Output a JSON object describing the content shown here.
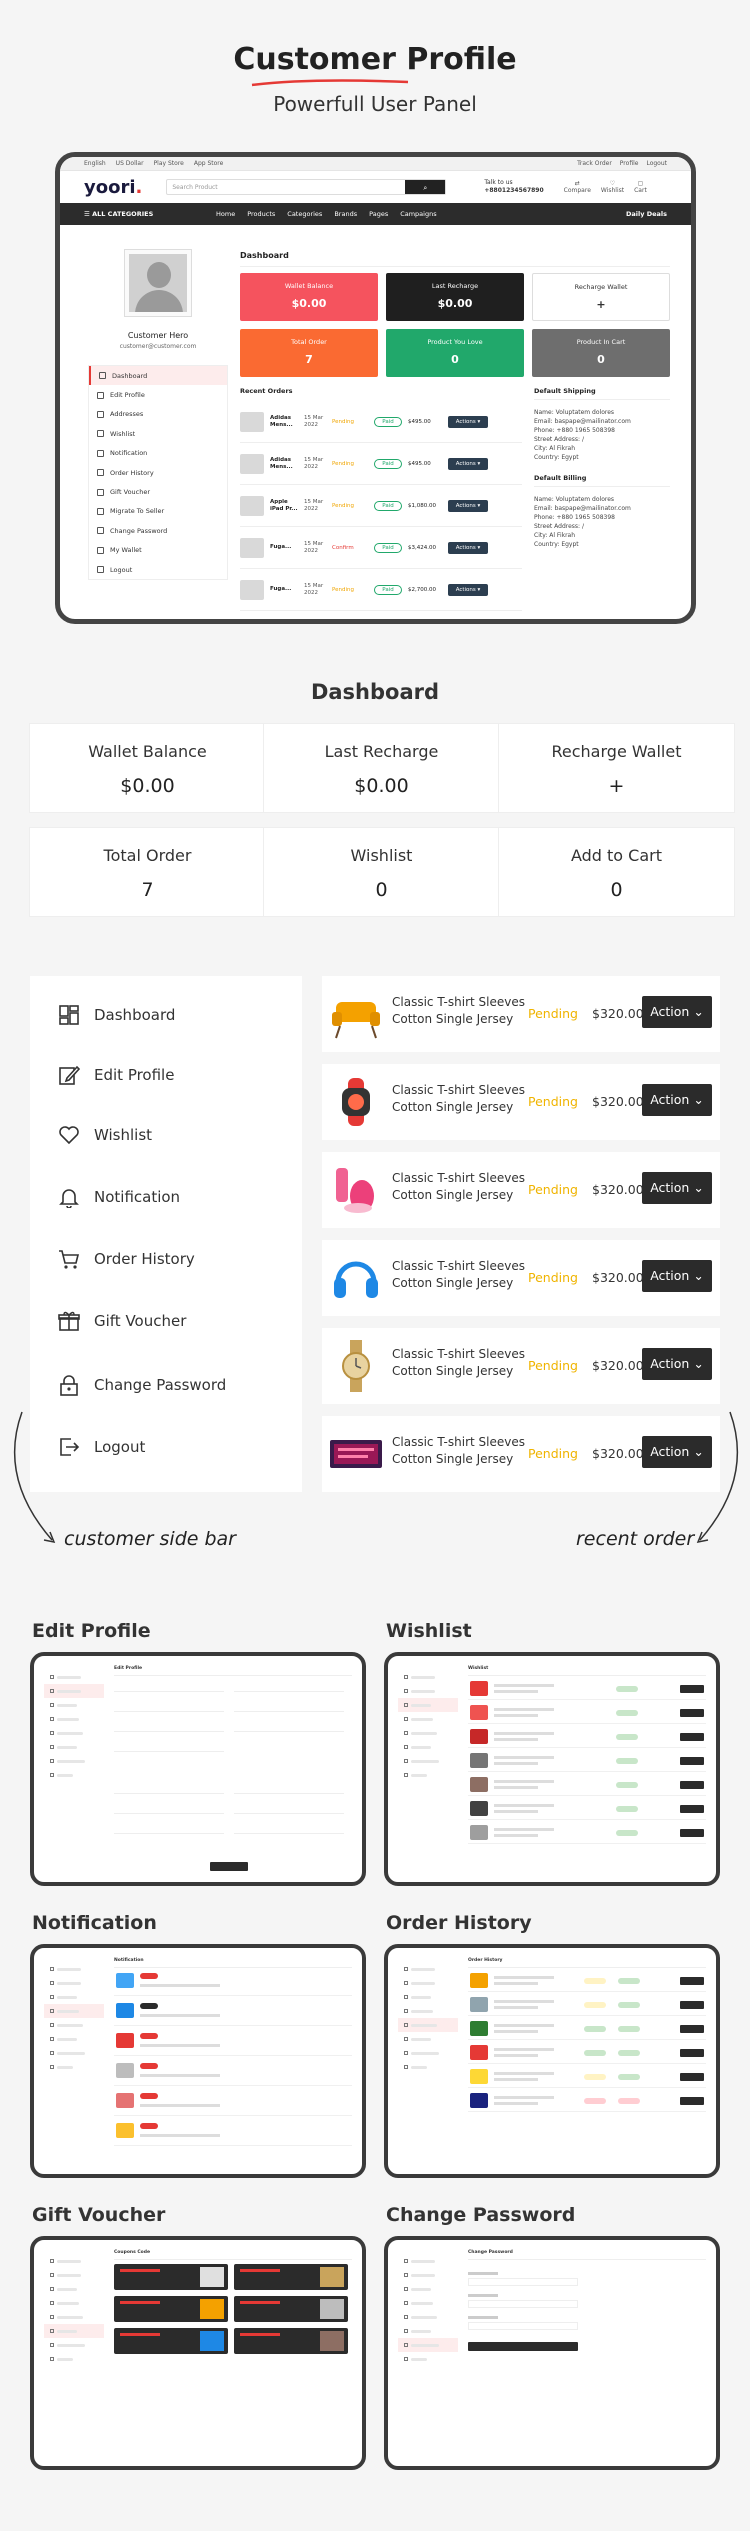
{
  "hero": {
    "title": "Customer Profile",
    "subtitle": "Powerfull User Panel"
  },
  "mock": {
    "topbar": {
      "language": "English",
      "currency": "US Dollar",
      "play_store": "Play Store",
      "app_store": "App Store",
      "track_order": "Track Order",
      "profile": "Profile",
      "logout": "Logout"
    },
    "header": {
      "logo": "yoori",
      "search_placeholder": "Search Product",
      "talk_to_us": "Talk to us",
      "phone": "+8801234567890",
      "compare": "Compare",
      "wishlist": "Wishlist",
      "cart": "Cart"
    },
    "nav": {
      "all_categories": "ALL CATEGORIES",
      "items": [
        "Home",
        "Products",
        "Categories",
        "Brands",
        "Pages",
        "Campaigns"
      ],
      "daily_deals": "Daily Deals"
    },
    "user": {
      "name": "Customer Hero",
      "email": "customer@customer.com"
    },
    "menu": [
      "Dashboard",
      "Edit Profile",
      "Addresses",
      "Wishlist",
      "Notification",
      "Order History",
      "Gift Voucher",
      "Migrate To Seller",
      "Change Password",
      "My Wallet",
      "Logout"
    ],
    "dashboard_title": "Dashboard",
    "cards": [
      {
        "label": "Wallet Balance",
        "value": "$0.00"
      },
      {
        "label": "Last Recharge",
        "value": "$0.00"
      },
      {
        "label": "Recharge Wallet",
        "value": "+"
      },
      {
        "label": "Total Order",
        "value": "7"
      },
      {
        "label": "Product You Love",
        "value": "0"
      },
      {
        "label": "Product In Cart",
        "value": "0"
      }
    ],
    "recent_orders_title": "Recent Orders",
    "orders": [
      {
        "name": "Adidas Mens...",
        "date": "15 Mar 2022",
        "status": "Pending",
        "paid": "Paid",
        "price": "$495.00",
        "action": "Actions"
      },
      {
        "name": "Adidas Mens...",
        "date": "15 Mar 2022",
        "status": "Pending",
        "paid": "Paid",
        "price": "$495.00",
        "action": "Actions"
      },
      {
        "name": "Apple iPad Pr...",
        "date": "15 Mar 2022",
        "status": "Pending",
        "paid": "Paid",
        "price": "$1,080.00",
        "action": "Actions"
      },
      {
        "name": "Fuga...",
        "date": "15 Mar 2022",
        "status": "Confirm",
        "paid": "Paid",
        "price": "$3,424.00",
        "action": "Actions"
      },
      {
        "name": "Fuga...",
        "date": "15 Mar 2022",
        "status": "Pending",
        "paid": "Paid",
        "price": "$2,700.00",
        "action": "Actions"
      }
    ],
    "shipping": {
      "title": "Default Shipping",
      "lines": [
        "Name: Voluptatem dolores",
        "Email: baspape@mailinator.com",
        "Phone: +880 1965 508398",
        "Street Address: /",
        "City: Al Fikrah",
        "Country: Egypt"
      ]
    },
    "billing": {
      "title": "Default Billing",
      "lines": [
        "Name: Voluptatem dolores",
        "Email: baspape@mailinator.com",
        "Phone: +880 1965 508398",
        "Street Address: /",
        "City: Al Fikrah",
        "Country: Egypt"
      ]
    }
  },
  "dashboard": {
    "title": "Dashboard",
    "cards": [
      {
        "label": "Wallet Balance",
        "value": "$0.00"
      },
      {
        "label": "Last Recharge",
        "value": "$0.00"
      },
      {
        "label": "Recharge Wallet",
        "value": "+"
      },
      {
        "label": "Total Order",
        "value": "7"
      },
      {
        "label": "Wishlist",
        "value": "0"
      },
      {
        "label": "Add to Cart",
        "value": "0"
      }
    ]
  },
  "sidebar": {
    "items": [
      "Dashboard",
      "Edit Profile",
      "Wishlist",
      "Notification",
      "Order History",
      "Gift Voucher",
      "Change Password",
      "Logout"
    ],
    "caption": "customer side bar"
  },
  "recent_orders": {
    "caption": "recent order",
    "items": [
      {
        "title1": "Classic T-shirt Sleeves",
        "title2": "Cotton Single Jersey",
        "status": "Pending",
        "price": "$320.00",
        "action": "Action",
        "image": "chair"
      },
      {
        "title1": "Classic T-shirt Sleeves",
        "title2": "Cotton Single Jersey",
        "status": "Pending",
        "price": "$320.00",
        "action": "Action",
        "image": "smartwatch"
      },
      {
        "title1": "Classic T-shirt Sleeves",
        "title2": "Cotton Single Jersey",
        "status": "Pending",
        "price": "$320.00",
        "action": "Action",
        "image": "cosmetics"
      },
      {
        "title1": "Classic T-shirt Sleeves",
        "title2": "Cotton Single Jersey",
        "status": "Pending",
        "price": "$320.00",
        "action": "Action",
        "image": "headphones"
      },
      {
        "title1": "Classic T-shirt Sleeves",
        "title2": "Cotton Single Jersey",
        "status": "Pending",
        "price": "$320.00",
        "action": "Action",
        "image": "wristwatch"
      },
      {
        "title1": "Classic T-shirt Sleeves",
        "title2": "Cotton Single Jersey",
        "status": "Pending",
        "price": "$320.00",
        "action": "Action",
        "image": "keyboard"
      }
    ]
  },
  "previews": [
    {
      "label": "Edit Profile",
      "inner_title": "Edit Profile"
    },
    {
      "label": "Wishlist",
      "inner_title": "Wishlist"
    },
    {
      "label": "Notification",
      "inner_title": "Notification"
    },
    {
      "label": "Order History",
      "inner_title": "Order History"
    },
    {
      "label": "Gift Voucher",
      "inner_title": "Coupons Code"
    },
    {
      "label": "Change Password",
      "inner_title": "Change Password"
    }
  ],
  "colors": {
    "accent_red": "#e53935",
    "pending": "#f0b400",
    "dark_button": "#2b2b2b",
    "paid_green": "#21a86b"
  }
}
